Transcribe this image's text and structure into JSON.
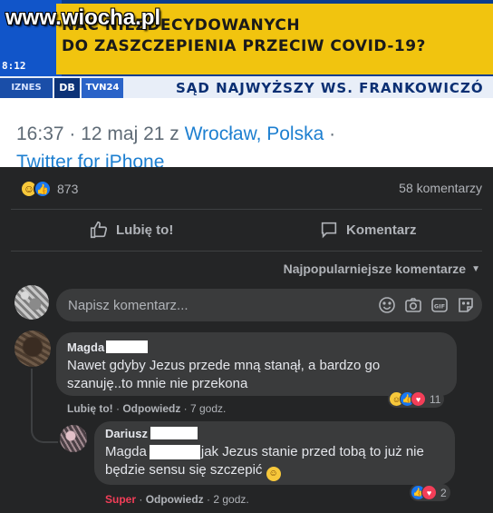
{
  "watermark": "www.wiocha.pl",
  "tv": {
    "headline_line1": "NAĆ NIEZDECYDOWANYCH",
    "headline_line2": "DO ZASZCZEPIENIA PRZECIW COVID-19?",
    "clock": "8:12",
    "channel_tag": "IZNES",
    "channel_b": "DB",
    "channel_tvn": "TVN24",
    "ticker": "SĄD NAJWYŻSZY WS. FRANKOWICZÓ"
  },
  "tweet": {
    "time": "16:37 · 12 maj 21 z ",
    "location": "Wrocław, Polska",
    "location_suffix": " ·",
    "source": "Twitter for iPhone"
  },
  "post": {
    "reaction_count": "873",
    "comments_count": "58 komentarzy",
    "like_label": "Lubię to!",
    "comment_label": "Komentarz",
    "sort_label": "Najpopularniejsze komentarze",
    "input_placeholder": "Napisz komentarz..."
  },
  "comments": [
    {
      "author": "Magda",
      "text_line1": "Nawet gdyby Jezus przede mną stanął, a bardzo go",
      "text_line2": "szanuję..to mnie nie przekona",
      "like": "Lubię to!",
      "reply": "Odpowiedz",
      "time": "7 godz.",
      "reactions": "11"
    },
    {
      "author": "Dariusz",
      "mention": "Magda",
      "text_line1": "jak Jezus stanie przed tobą to już nie",
      "text_line2": "będzie sensu się szczepić",
      "like": "Super",
      "reply": "Odpowiedz",
      "time": "2 godz.",
      "reactions": "2"
    }
  ],
  "colors": {
    "fb_bg": "#242526",
    "bubble": "#3a3b3c",
    "text": "#e4e6eb",
    "muted": "#b0b3b8",
    "link_blue": "#1d7fd0",
    "tv_yellow": "#f1c40f"
  }
}
